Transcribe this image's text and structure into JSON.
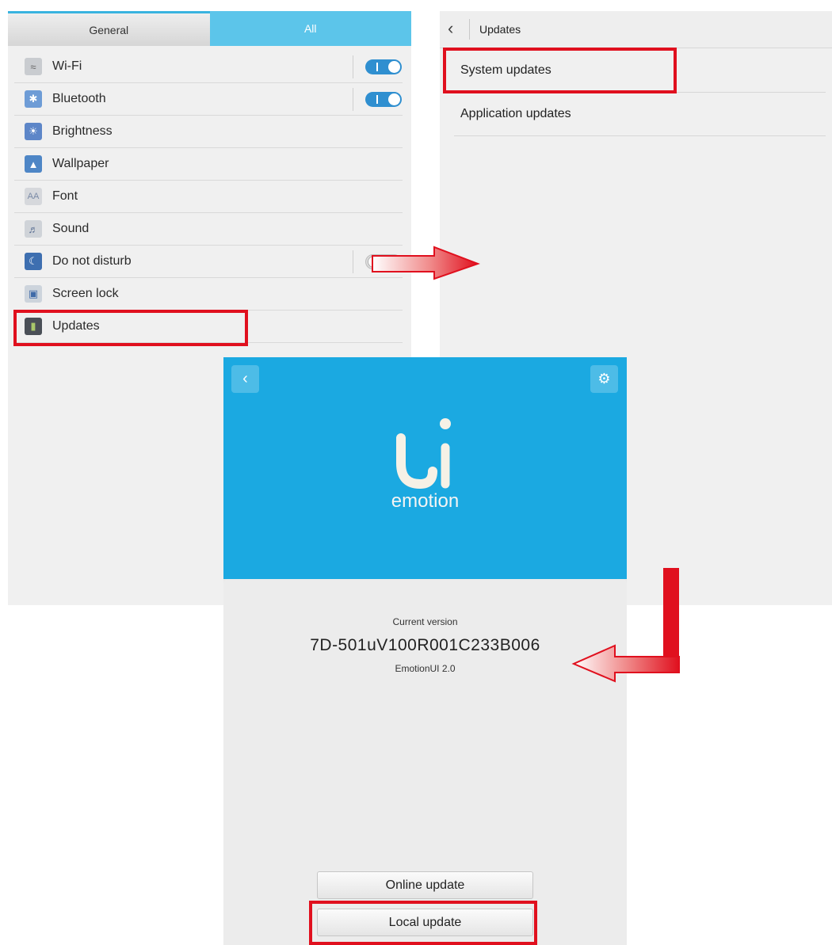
{
  "settings": {
    "tabs": [
      {
        "label": "General",
        "selected": true
      },
      {
        "label": "All",
        "selected": false
      }
    ],
    "items": [
      {
        "label": "Wi-Fi",
        "icon": "wifi-icon",
        "toggle": "on"
      },
      {
        "label": "Bluetooth",
        "icon": "bluetooth-icon",
        "toggle": "on"
      },
      {
        "label": "Brightness",
        "icon": "brightness-icon",
        "toggle": null
      },
      {
        "label": "Wallpaper",
        "icon": "wallpaper-icon",
        "toggle": null
      },
      {
        "label": "Font",
        "icon": "font-icon",
        "toggle": null
      },
      {
        "label": "Sound",
        "icon": "sound-icon",
        "toggle": null
      },
      {
        "label": "Do not disturb",
        "icon": "moon-icon",
        "toggle": "off"
      },
      {
        "label": "Screen lock",
        "icon": "lock-icon",
        "toggle": null
      },
      {
        "label": "Updates",
        "icon": "updates-icon",
        "toggle": null,
        "highlighted": true
      }
    ]
  },
  "updates_list": {
    "back_icon": "chevron-left-icon",
    "title": "Updates",
    "items": [
      {
        "label": "System updates",
        "highlighted": true
      },
      {
        "label": "Application updates",
        "highlighted": false
      }
    ]
  },
  "emotion": {
    "back_icon": "chevron-left-icon",
    "settings_icon": "gear-icon",
    "logo_text": "emotion",
    "current_version_label": "Current version",
    "current_version": "7D-501uV100R001C233B006",
    "ui_version": "EmotionUI 2.0",
    "buttons": [
      {
        "label": "Online update",
        "highlighted": false
      },
      {
        "label": "Local update",
        "highlighted": true
      }
    ]
  },
  "colors": {
    "accent_blue": "#1ba9e1",
    "tab_blue": "#5cc5ea",
    "toggle_blue": "#2f8fd0",
    "annotation_red": "#e0101e"
  }
}
